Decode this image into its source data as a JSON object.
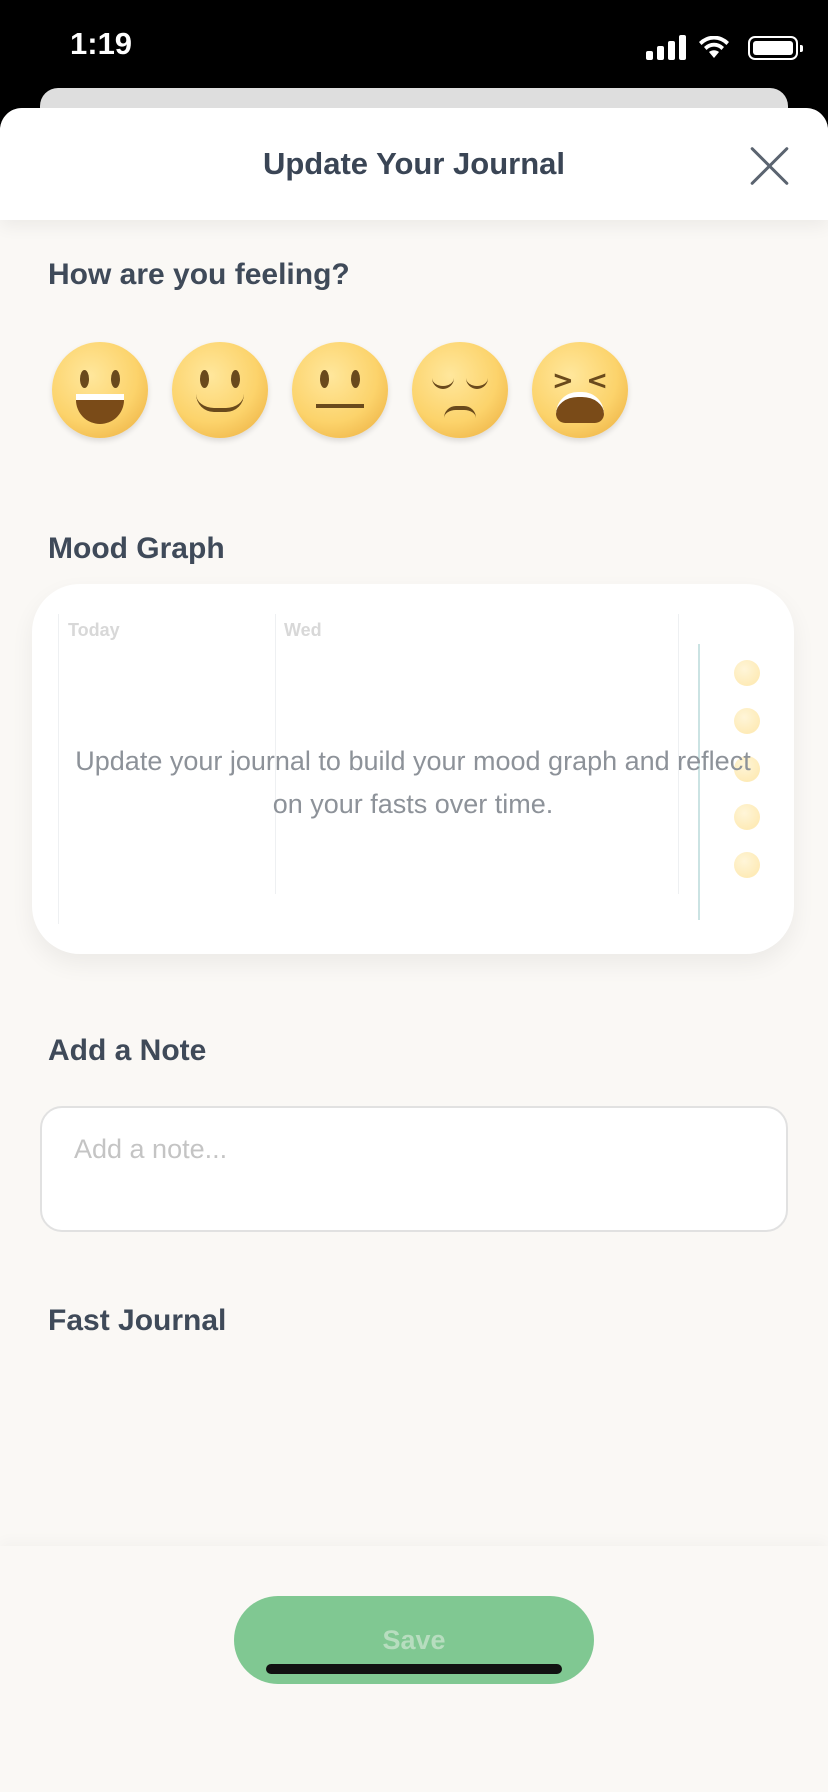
{
  "status_bar": {
    "time": "1:19"
  },
  "header": {
    "title": "Update Your Journal"
  },
  "feeling": {
    "title": "How are you feeling?",
    "moods": [
      "grinning-face-icon",
      "slightly-smiling-face-icon",
      "neutral-face-icon",
      "pensive-face-icon",
      "tired-face-icon"
    ]
  },
  "mood_graph": {
    "title": "Mood Graph",
    "days": [
      "Today",
      "Wed"
    ],
    "empty_message": "Update your journal to build your mood graph and reflect on your fasts over time."
  },
  "note": {
    "title": "Add a Note",
    "placeholder": "Add a note...",
    "value": ""
  },
  "fast_journal": {
    "title": "Fast Journal"
  },
  "footer": {
    "save_label": "Save"
  },
  "colors": {
    "accent": "#80c892",
    "title_text": "#3f4a59",
    "background": "#faf8f5"
  }
}
